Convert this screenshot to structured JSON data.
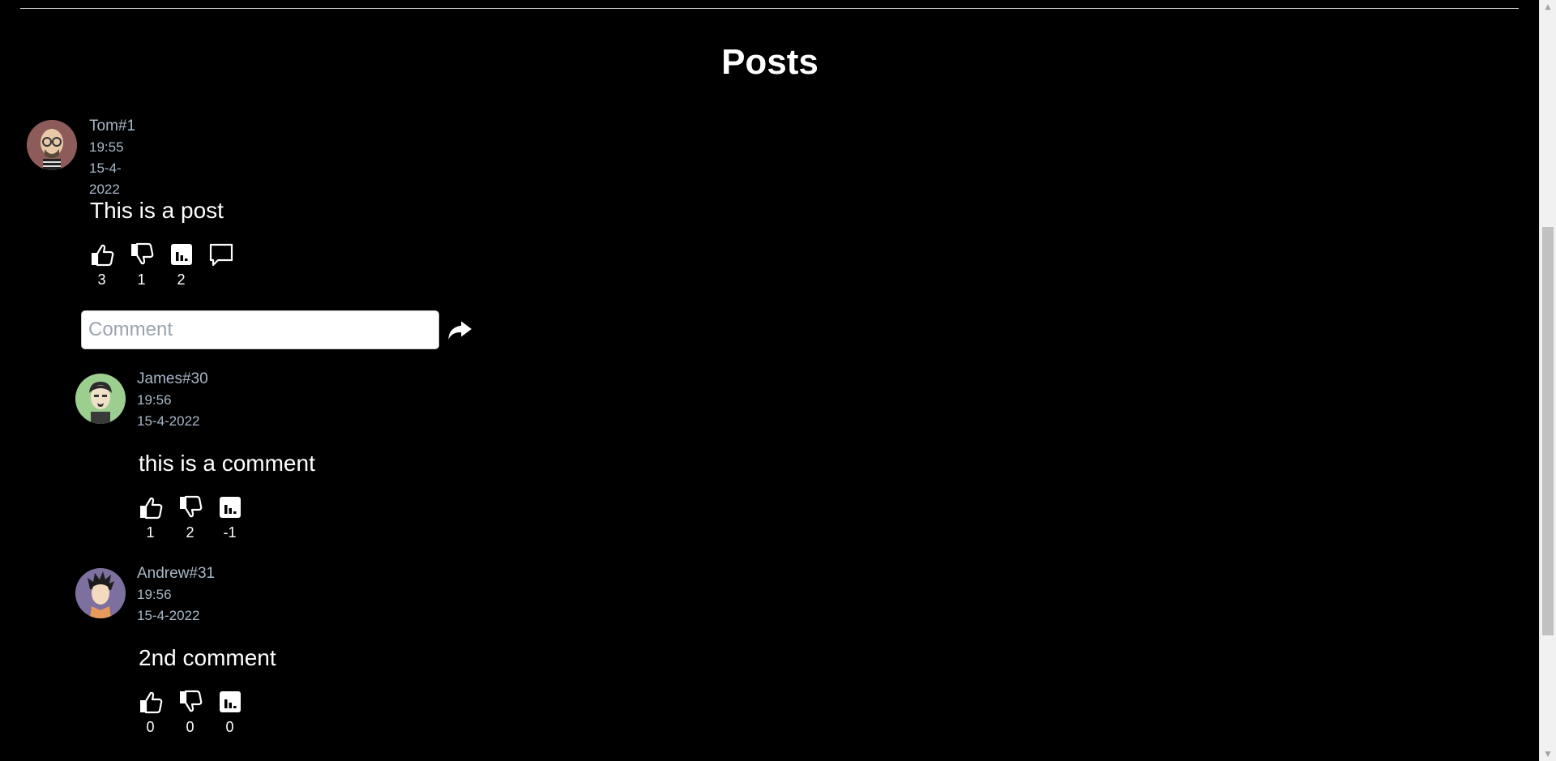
{
  "page": {
    "title": "Posts"
  },
  "post": {
    "author": "Tom#1",
    "time": "19:55",
    "date": "15-4-2022",
    "text": "This is a post",
    "likes": "3",
    "dislikes": "1",
    "score": "2"
  },
  "comment_form": {
    "placeholder": "Comment"
  },
  "comments": [
    {
      "author": "James#30",
      "time": "19:56",
      "date": "15-4-2022",
      "text": "this is a comment",
      "likes": "1",
      "dislikes": "2",
      "score": "-1"
    },
    {
      "author": "Andrew#31",
      "time": "19:56",
      "date": "15-4-2022",
      "text": "2nd comment",
      "likes": "0",
      "dislikes": "0",
      "score": "0"
    }
  ],
  "icons": {
    "like": "thumbs-up-icon",
    "dislike": "thumbs-down-icon",
    "score": "bar-chart-icon",
    "comment": "speech-bubble-icon",
    "send": "share-arrow-icon"
  },
  "colors": {
    "background": "#000000",
    "meta_text": "#a9b8c8",
    "avatar_tom": "#8e5b5b",
    "avatar_james": "#9ccf8f",
    "avatar_andrew": "#7d6f9e"
  }
}
